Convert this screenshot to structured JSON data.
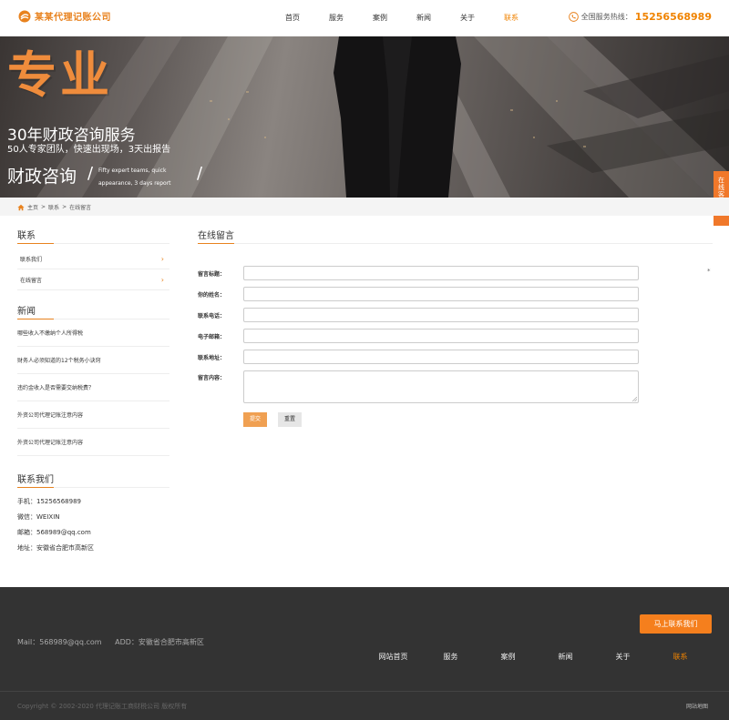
{
  "header": {
    "logo_text": "某某代理记账公司",
    "nav": [
      "首页",
      "服务",
      "案例",
      "新闻",
      "关于",
      "联系"
    ],
    "active_nav": "联系",
    "hotline_label": "全国服务热线：",
    "hotline_number": "15256568989"
  },
  "banner": {
    "big_title": "专业",
    "line1": "30年财政咨询服务",
    "line2": "50人专家团队，快速出现场，3天出报告",
    "line3": "财政咨询",
    "line3_en": "Fifty expert teams, quick appearance, 3 days report",
    "slash": "/"
  },
  "side_tab": {
    "text": "在线客服",
    "chevron": "«"
  },
  "breadcrumb": {
    "home": "主页",
    "sep": ">",
    "level1": "联系",
    "level2": "在线留言"
  },
  "sidebar": {
    "section1_title": "联系",
    "menu": [
      "联系我们",
      "在线留言"
    ],
    "section2_title": "新闻",
    "news": [
      "哪些收入不缴纳个人所得税",
      "财务人必须知道的12个税务小诀窍",
      "违约金收入是否需要交纳税费？",
      "外资公司代理记账注意内容",
      "外资公司代理记账注意内容"
    ],
    "section3_title": "联系我们",
    "contact": [
      "手机：15256568989",
      "微信：WEIXIN",
      "邮箱：568989@qq.com",
      "地址：安徽省合肥市高新区"
    ]
  },
  "main": {
    "title": "在线留言",
    "required_mark": "*",
    "fields": [
      "留言标题：",
      "你的姓名：",
      "联系电话：",
      "电子邮箱：",
      "联系地址：",
      "留言内容："
    ],
    "submit_label": "提交",
    "reset_label": "重置"
  },
  "footer": {
    "cta_label": "马上联系我们",
    "mail": "Mail：568989@qq.com",
    "address": "ADD：安徽省合肥市高新区",
    "nav": [
      "网站首页",
      "服务",
      "案例",
      "新闻",
      "关于",
      "联系"
    ],
    "active_nav": "联系",
    "copyright": "Copyright © 2002-2020 代理记账工商财税公司 版权所有",
    "sitemap": "网站地图"
  },
  "colors": {
    "accent": "#f08300",
    "footer_bg": "#333333",
    "side_tab": "#f0782a"
  }
}
